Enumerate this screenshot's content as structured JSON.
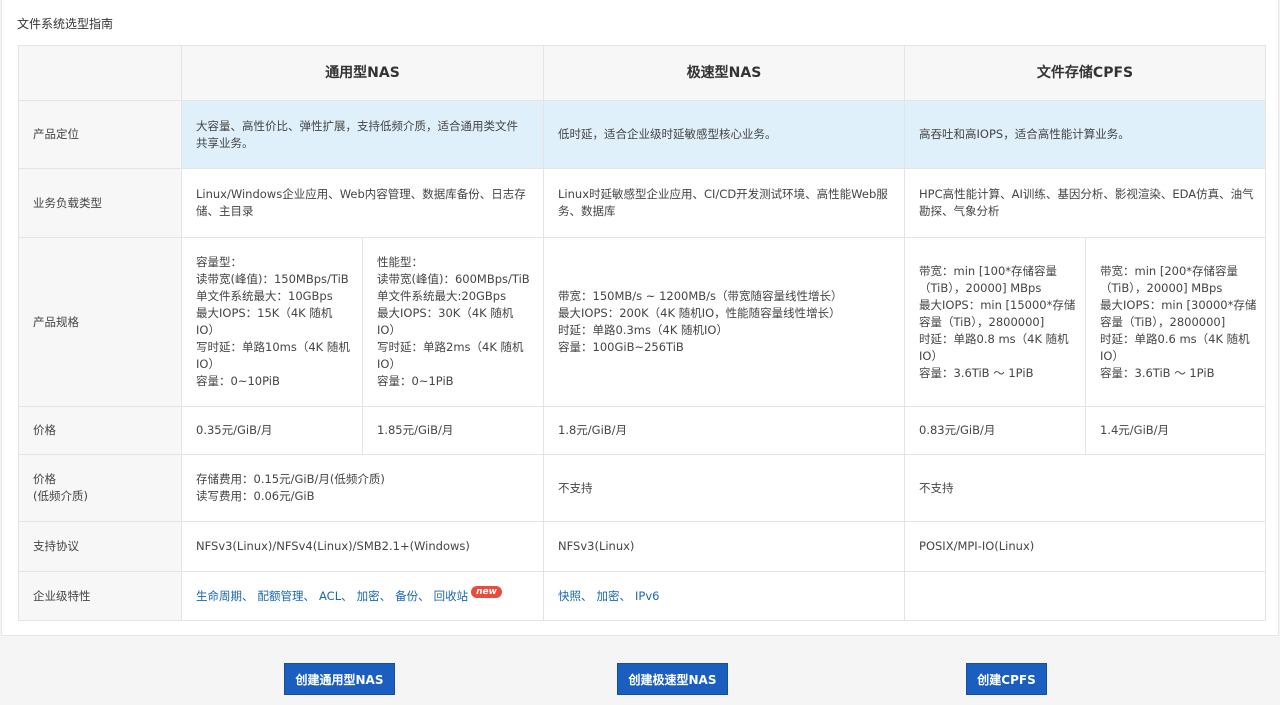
{
  "page": {
    "title": "文件系统选型指南"
  },
  "columns": [
    "通用型NAS",
    "极速型NAS",
    "文件存储CPFS"
  ],
  "rows": {
    "positioning": {
      "label": "产品定位",
      "general": [
        "大容量、高性价比、弹性扩展，支持低频介质，适合通用类文件",
        "共享业务。"
      ],
      "extreme": "低时延，适合企业级时延敏感型核心业务。",
      "cpfs": "高吞吐和高IOPS，适合高性能计算业务。"
    },
    "workload": {
      "label": "业务负载类型",
      "general": [
        "Linux/Windows企业应用、Web内容管理、数据库备份、日志存",
        "储、主目录"
      ],
      "extreme": [
        "Linux时延敏感型企业应用、CI/CD开发测试环境、高性能Web服",
        "务、数据库"
      ],
      "cpfs": [
        "HPC高性能计算、AI训练、基因分析、影视渲染、EDA仿真、油气",
        "勘探、气象分析"
      ]
    },
    "spec": {
      "label": "产品规格",
      "general_capacity": [
        "容量型：",
        "读带宽(峰值)：150MBps/TiB",
        "单文件系统最大：10GBps",
        "最大IOPS：15K（4K 随机",
        "IO）",
        "写时延：单路10ms（4K 随机",
        "IO）",
        "容量：0~10PiB"
      ],
      "general_performance": [
        "性能型：",
        "读带宽(峰值)：600MBps/TiB",
        "单文件系统最大:20GBps",
        "最大IOPS：30K（4K 随机",
        "IO）",
        "写时延：单路2ms（4K 随机",
        "IO）",
        "容量：0~1PiB"
      ],
      "extreme": [
        "带宽：150MB/s ~ 1200MB/s（带宽随容量线性增长）",
        "最大IOPS：200K（4K 随机IO，性能随容量线性增长）",
        "时延：单路0.3ms（4K 随机IO）",
        "容量：100GiB~256TiB"
      ],
      "cpfs_a": [
        "带宽：min [100*存储容量",
        "（TiB），20000] MBps",
        "最大IOPS：min [15000*存储",
        "容量（TiB），2800000]",
        "时延：单路0.8 ms（4K 随机",
        "IO）",
        "容量：3.6TiB ～ 1PiB"
      ],
      "cpfs_b": [
        "带宽：min [200*存储容量",
        "（TiB），20000] MBps",
        "最大IOPS：min [30000*存储",
        "容量（TiB），2800000]",
        "时延：单路0.6 ms（4K 随机",
        "IO）",
        "容量：3.6TiB ～ 1PiB"
      ]
    },
    "price": {
      "label": "价格",
      "general_capacity": "0.35元/GiB/月",
      "general_performance": "1.85元/GiB/月",
      "extreme": "1.8元/GiB/月",
      "cpfs_a": "0.83元/GiB/月",
      "cpfs_b": "1.4元/GiB/月"
    },
    "price_low": {
      "label_line1": "价格",
      "label_line2": "(低频介质)",
      "general": [
        "存储费用：0.15元/GiB/月(低频介质)",
        "读写费用：0.06元/GiB"
      ],
      "extreme": "不支持",
      "cpfs": "不支持"
    },
    "protocol": {
      "label": "支持协议",
      "general": "NFSv3(Linux)/NFSv4(Linux)/SMB2.1+(Windows)",
      "extreme": "NFSv3(Linux)",
      "cpfs": "POSIX/MPI-IO(Linux)"
    },
    "enterprise": {
      "label": "企业级特性",
      "general": [
        "生命周期",
        "配额管理",
        "ACL",
        "加密",
        "备份",
        "回收站"
      ],
      "general_badge": "new",
      "extreme": [
        "快照",
        "加密",
        "IPv6"
      ]
    }
  },
  "buttons": {
    "create_general": "创建通用型NAS",
    "create_extreme": "创建极速型NAS",
    "create_cpfs": "创建CPFS"
  },
  "colors": {
    "highlight": "#dff0fb",
    "link": "#1a66b3",
    "button": "#1a5fc0",
    "badge": "#e74c3c"
  }
}
